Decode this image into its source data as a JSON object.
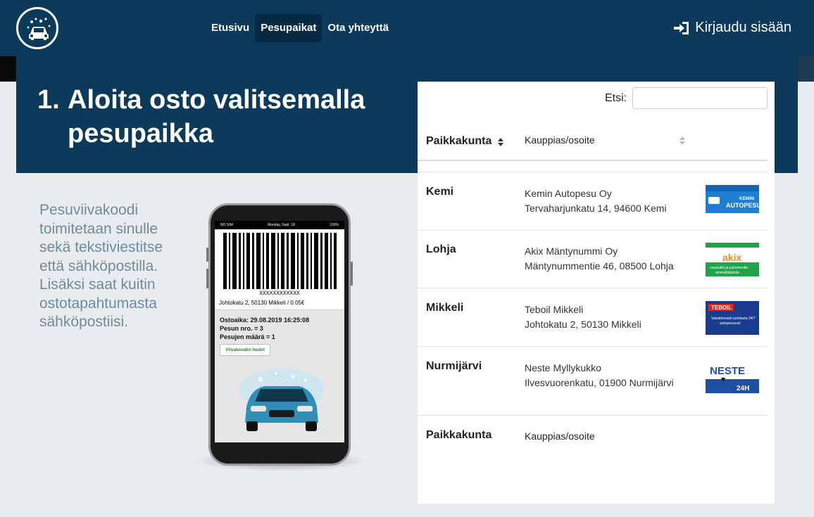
{
  "nav": {
    "items": [
      {
        "label": "Etusivu",
        "active": false
      },
      {
        "label": "Pesupaikat",
        "active": true
      },
      {
        "label": "Ota yhteyttä",
        "active": false
      }
    ],
    "login_label": "Kirjaudu sisään"
  },
  "hero": {
    "number": "1.",
    "line1": "Aloita osto valitsemalla",
    "line2": "pesupaikka"
  },
  "description": "Pesuviivakoodi toimitetaan sinulle sekä tekstiviestitse että sähköpostilla. Lisäksi saat kuitin ostotapahtumasta sähköpostiisi.",
  "phone": {
    "status_left": "NO SIM",
    "status_center": "Monday, Sept. 18",
    "status_right": "100%",
    "code": "XXXXXXXXXXXX",
    "address_line": "Johtokatu 2, 50130 Mikkeli / 0.05€",
    "purchase_time": "Ostoaika: 29.08.2019 16:25:08",
    "wash_no": "Pesun nro. = 3",
    "wash_count": "Pesujen määrä = 1",
    "button_label": "Viivakoodin tiedot"
  },
  "table": {
    "search_label": "Etsi:",
    "search_value": "",
    "col_city": "Paikkakunta",
    "col_merchant": "Kauppias/osoite",
    "rows": [
      {
        "city": "Kemi",
        "merchant": "Kemin Autopesu Oy",
        "address": "Tervaharjunkatu 14, 94600 Kemi",
        "logo": "kemin-autopesu-logo"
      },
      {
        "city": "Lohja",
        "merchant": "Akix Mäntynummi Oy",
        "address": "Mäntynummentie 46, 08500 Lohja",
        "logo": "akix-logo"
      },
      {
        "city": "Mikkeli",
        "merchant": "Teboil Mikkeli",
        "address": "Johtokatu 2, 50130 Mikkeli",
        "logo": "teboil-logo"
      },
      {
        "city": "Nurmijärvi",
        "merchant": "Neste Myllykukko",
        "address": "Ilvesvuorenkatu, 01900 Nurmijärvi",
        "logo": "neste-logo"
      }
    ],
    "footer_city": "Paikkakunta",
    "footer_merchant": "Kauppias/osoite"
  },
  "logo_texts": {
    "kemi": "KEMIN AUTOPESU",
    "akix": "akix",
    "akix_sub": "osaavalla ja palvelevalla ammattitaidolla",
    "teboil": "TEBOIL",
    "teboil_sub": "Vaivattomasti puhdasta 24/7 autopesussa!",
    "neste": "NESTE",
    "neste_sub": "24H"
  },
  "colors": {
    "navy": "#0c3a5b",
    "background": "#e9ecef",
    "description_text": "#708a9c"
  }
}
